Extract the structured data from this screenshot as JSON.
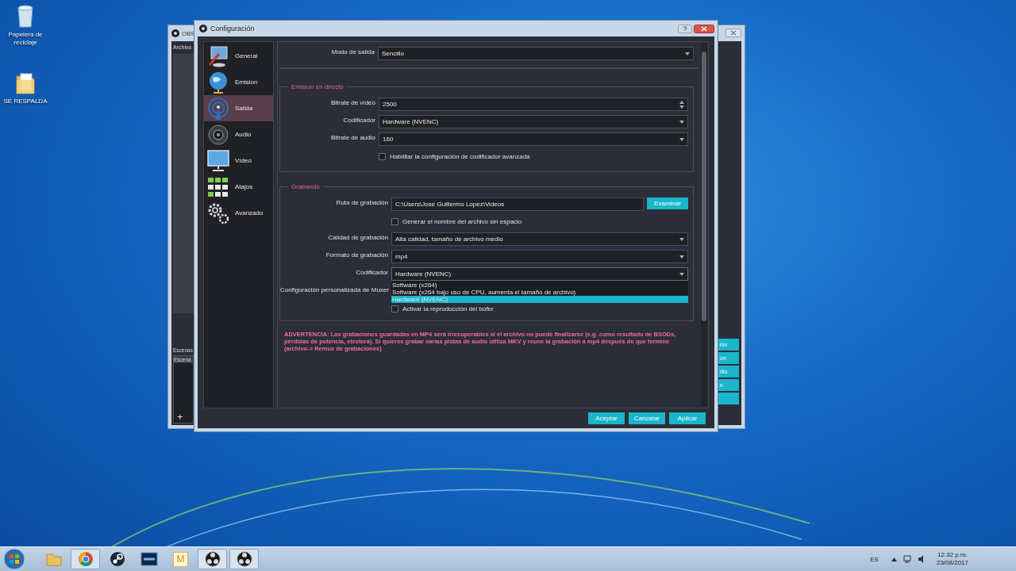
{
  "desktop_icons": [
    {
      "kind": "recycle-bin",
      "label": "Papelera de reciclaje"
    },
    {
      "kind": "folder",
      "label": "SE RESPALDA"
    }
  ],
  "obs_window": {
    "title": "OBS",
    "menu": [
      "Archivo"
    ],
    "scenes_label": "Escenas",
    "scenes": [
      {
        "label": "Escena",
        "selected": true
      }
    ],
    "add_button": "+",
    "side_buttons": [
      {
        "kind": "text",
        "label": "ión"
      },
      {
        "kind": "text",
        "label": "ón"
      },
      {
        "kind": "text",
        "label": "dio"
      },
      {
        "kind": "text",
        "label": "n"
      },
      {
        "kind": "blank"
      }
    ]
  },
  "dialog": {
    "title": "Configuración",
    "sidebar": [
      {
        "label": "General",
        "selected": false
      },
      {
        "label": "Emision",
        "selected": false
      },
      {
        "label": "Salida",
        "selected": true
      },
      {
        "label": "Audio",
        "selected": false
      },
      {
        "label": "Vídeo",
        "selected": false
      },
      {
        "label": "Atajos",
        "selected": false
      },
      {
        "label": "Avanzado",
        "selected": false
      }
    ],
    "output_mode": {
      "label": "Modo de salida",
      "value": "Sencillo"
    },
    "groups": [
      {
        "title": "Emision en directo",
        "rows": [
          {
            "kind": "spin",
            "label": "Bitrate de vídeo",
            "value": "2500"
          },
          {
            "kind": "select",
            "label": "Codificador",
            "value": "Hardware (NVENC)"
          },
          {
            "kind": "select",
            "label": "Bitrate de audio",
            "value": "160"
          },
          {
            "kind": "checkbox",
            "label": "Habilitar la configuración de codificador avanzada",
            "checked": false
          }
        ]
      },
      {
        "title": "Grabando",
        "rows": [
          {
            "kind": "path",
            "label": "Ruta de grabación",
            "value": "C:\\Users\\Jose Guillermo Lopez\\Videos",
            "button": "Examinar"
          },
          {
            "kind": "checkbox",
            "label": "Generar el nombre del archivo sin espacio",
            "checked": false
          },
          {
            "kind": "select",
            "label": "Calidad de grabación",
            "value": "Alta calidad, tamaño de archivo medio"
          },
          {
            "kind": "select",
            "label": "Formato de grabación",
            "value": "mp4"
          },
          {
            "kind": "select",
            "label": "Codificador",
            "value": "Hardware (NVENC)",
            "expanded": true,
            "options": [
              {
                "label": "Software (x264)",
                "selected": false
              },
              {
                "label": "Software (x264 bajo uso de CPU, aumenta el tamaño de archivo)",
                "selected": false
              },
              {
                "label": "Hardware (NVENC)",
                "selected": true
              }
            ]
          },
          {
            "kind": "text",
            "label": "Configuración personalizada de Muxer"
          },
          {
            "kind": "checkbox",
            "label": "Activar la reproducción del búfer",
            "checked": false
          }
        ]
      }
    ],
    "warning": "ADVERTENCIA: Las grabaciones guardadas en MP4 será irrecuperables si el archivo no puede finalizarse (e.g. como resultado de BSODs, pérdidas de potencia, etcetera). Si quieres grabar varias pistas de audio utiliza MKV y reune la grabación a mp4 después de que termine (archivo-> Remux de grabaciones)",
    "buttons": [
      "Aceptar",
      "Cancelar",
      "Aplicar"
    ]
  },
  "taskbar": {
    "apps": [
      {
        "kind": "folder",
        "running": false
      },
      {
        "kind": "browser",
        "running": true
      },
      {
        "kind": "steam",
        "running": false
      },
      {
        "kind": "tile",
        "running": false
      },
      {
        "kind": "letter",
        "label": "M",
        "running": false
      },
      {
        "kind": "obs",
        "running": true
      },
      {
        "kind": "obs",
        "running": true
      }
    ],
    "tray": {
      "language": "ES",
      "time": "12:32 p.m.",
      "date": "23/08/2017"
    }
  }
}
